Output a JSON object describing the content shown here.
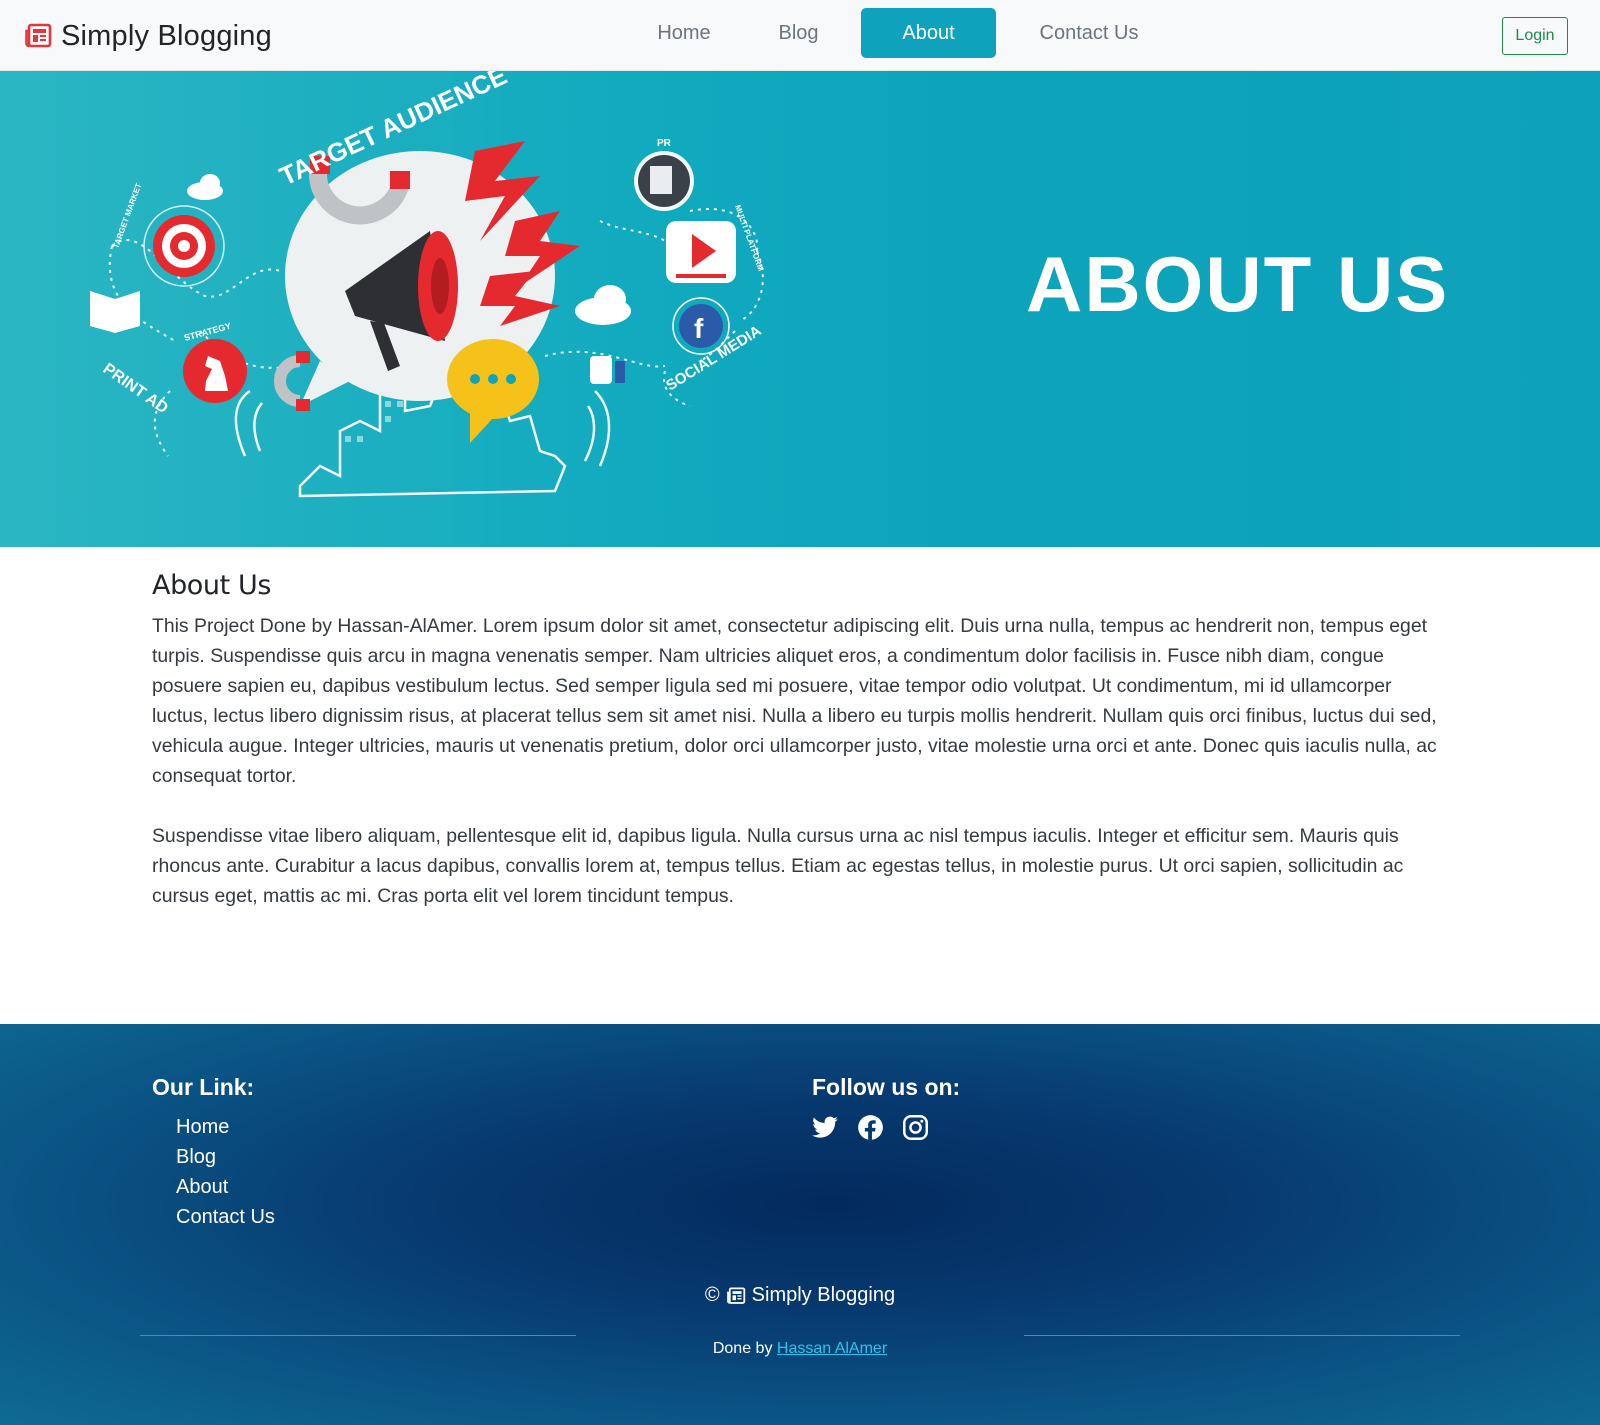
{
  "navbar": {
    "brand": {
      "icon": "newspaper-icon",
      "text": "Simply Blogging",
      "icon_color": "#e4373d"
    },
    "items": [
      {
        "label": "Home",
        "active": false
      },
      {
        "label": "Blog",
        "active": false
      },
      {
        "label": "About",
        "active": true
      },
      {
        "label": "Contact Us",
        "active": false
      }
    ],
    "login_label": "Login",
    "active_color": "#0ea2bd",
    "login_color": "#1e8a4a"
  },
  "hero": {
    "title": "ABOUT US",
    "illustration_labels": {
      "target_audience": "TARGET AUDIENCE",
      "pr": "PR",
      "target_market": "TARGET MARKET",
      "strategy": "STRATEGY",
      "print_ad": "PRINT AD",
      "multi_platform": "MULTI PLATFORM",
      "social_media": "SOCIAL MEDIA"
    },
    "background": "#0ea4bb"
  },
  "about": {
    "heading": "About Us",
    "paragraphs": [
      "This Project Done by Hassan-AlAmer. Lorem ipsum dolor sit amet, consectetur adipiscing elit. Duis urna nulla, tempus ac hendrerit non, tempus eget turpis. Suspendisse quis arcu in magna venenatis semper. Nam ultricies aliquet eros, a condimentum dolor facilisis in. Fusce nibh diam, congue posuere sapien eu, dapibus vestibulum lectus. Sed semper ligula sed mi posuere, vitae tempor odio volutpat. Ut condimentum, mi id ullamcorper luctus, lectus libero dignissim risus, at placerat tellus sem sit amet nisi. Nulla a libero eu turpis mollis hendrerit. Nullam quis orci finibus, luctus dui sed, vehicula augue. Integer ultricies, mauris ut venenatis pretium, dolor orci ullamcorper justo, vitae molestie urna orci et ante. Donec quis iaculis nulla, ac consequat tortor.",
      "Suspendisse vitae libero aliquam, pellentesque elit id, dapibus ligula. Nulla cursus urna ac nisl tempus iaculis. Integer et efficitur sem. Mauris quis rhoncus ante. Curabitur a lacus dapibus, convallis lorem at, tempus tellus. Etiam ac egestas tellus, in molestie purus. Ut orci sapien, sollicitudin ac cursus eget, mattis ac mi. Cras porta elit vel lorem tincidunt tempus."
    ]
  },
  "footer": {
    "links_title": "Our Link:",
    "links": [
      "Home",
      "Blog",
      "About",
      "Contact Us"
    ],
    "follow_title": "Follow us on:",
    "social_icons": [
      "twitter-icon",
      "facebook-icon",
      "instagram-icon"
    ],
    "copyright_symbol": "©",
    "copyright_text": "Simply Blogging",
    "done_by_prefix": "Done by",
    "author": "Hassan AlAmer",
    "link_color": "#2bc4ee"
  }
}
